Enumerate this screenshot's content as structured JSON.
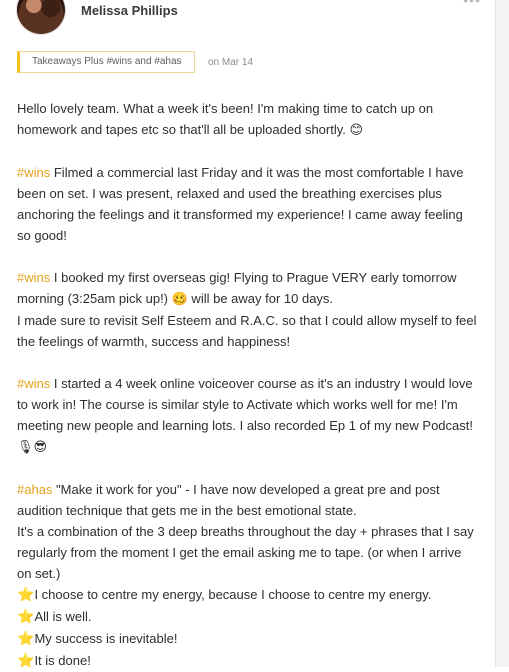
{
  "post": {
    "author_name": "Melissa Phillips",
    "tag_label": "Takeaways Plus #wins and #ahas",
    "date": "on Mar 14"
  },
  "content": {
    "intro": "Hello lovely team. What a week it's been! I'm making time to catch up on homework and tapes etc so that'll all be uploaded shortly. ",
    "intro_emoji": "😊",
    "win1_tag": "#wins",
    "win1_text": " Filmed a commercial last Friday and it was the most comfortable I have been on set. I was present, relaxed and used the breathing exercises plus anchoring the feelings and it transformed my experience! I came away feeling so good!",
    "win2_tag": "#wins",
    "win2_text": " I booked my first overseas gig! Flying to Prague VERY early tomorrow morning (3:25am pick up!) ",
    "win2_emoji": "🥴",
    "win2_text_b": " will be away for 10 days.",
    "win2_line2": "I made sure to revisit Self Esteem and R.A.C. so that I could allow myself to feel the feelings of warmth, success and happiness!",
    "win3_tag": "#wins",
    "win3_text": " I started a 4 week online voiceover course as it's an industry I would love to work in! The course is similar style to Activate which works well for me! I'm meeting new people and learning lots. I also recorded Ep 1 of my new Podcast! ",
    "win3_emoji": "🎙😎",
    "aha_tag": "#ahas",
    "aha_text": " \"Make it work for you\" - I have now developed a great pre and post audition technique that gets me in the best emotional state.",
    "aha_line2": "It's a combination of the 3 deep breaths throughout the day + phrases that I say regularly from the moment I get the email asking me to tape. (or when I arrive on set.)",
    "star_glyph": "⭐",
    "affirmations": [
      "I choose to centre my energy, because I choose to centre my energy.",
      "All is well.",
      "My success is inevitable!",
      "It is done!"
    ]
  },
  "colors": {
    "hashtag": "#e3a21a",
    "tag_border": "#f3c51c"
  },
  "icons": {
    "menu": "more-dots-icon",
    "star": "star-icon"
  }
}
